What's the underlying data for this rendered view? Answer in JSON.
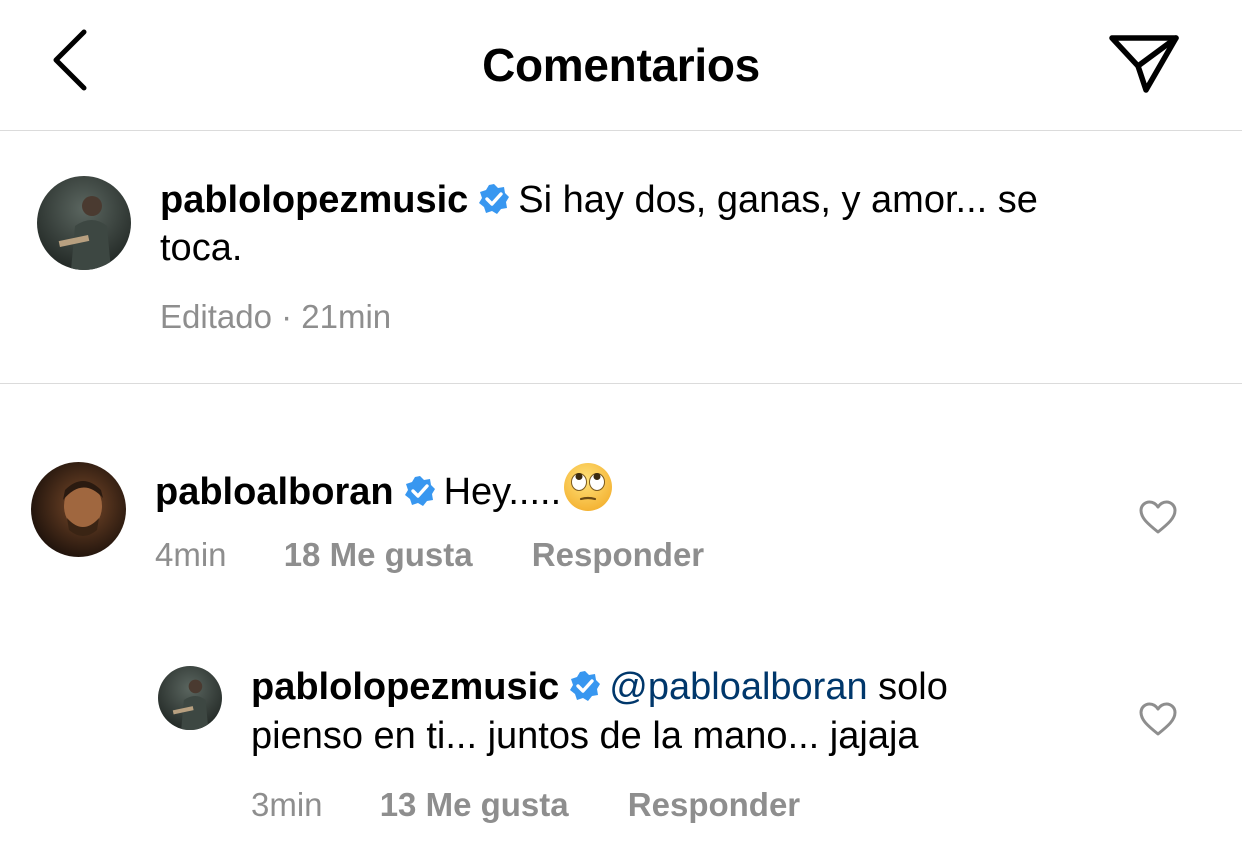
{
  "header": {
    "title": "Comentarios",
    "back_icon": "chevron-left-icon",
    "send_icon": "paper-plane-icon"
  },
  "caption": {
    "username": "pablolopezmusic",
    "text_line1": "Si hay dos,  ganas, y amor... se",
    "text_line2": "toca.",
    "edited": "Editado",
    "separator": "·",
    "time": "21min"
  },
  "comments": [
    {
      "username": "pabloalboran",
      "text": "Hey.....",
      "emoji": "face-with-rolling-eyes",
      "time": "4min",
      "likes": "18 Me gusta",
      "reply": "Responder"
    },
    {
      "username": "pablolopezmusic",
      "mention": "@pabloalboran",
      "text_line1": "solo",
      "text_line2": "pienso en ti... juntos de la mano... jajaja",
      "time": "3min",
      "likes": "13 Me gusta",
      "reply": "Responder"
    }
  ],
  "colors": {
    "verified": "#3897f0",
    "meta": "#8e8e8e",
    "mention": "#00376b",
    "divider": "#dbdbdb"
  }
}
